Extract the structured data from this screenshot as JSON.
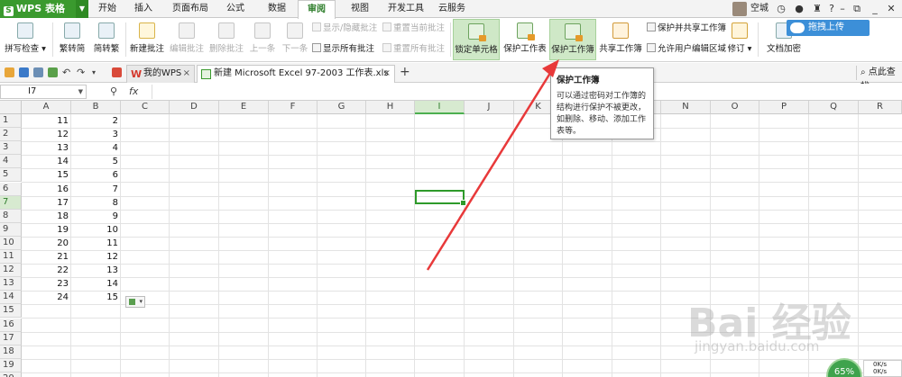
{
  "app": {
    "title": "WPS 表格",
    "accent": "#3a9a2e"
  },
  "menu_tabs": [
    {
      "label": "开始"
    },
    {
      "label": "插入"
    },
    {
      "label": "页面布局"
    },
    {
      "label": "公式"
    },
    {
      "label": "数据"
    },
    {
      "label": "审阅",
      "active": true
    },
    {
      "label": "视图"
    },
    {
      "label": "开发工具"
    },
    {
      "label": "云服务"
    }
  ],
  "user": {
    "name": "空城"
  },
  "ribbon": {
    "spellcheck": "拼写检查",
    "trad_to_simp": "繁转简",
    "simp_to_trad": "简转繁",
    "new_comment": "新建批注",
    "edit_comment": "编辑批注",
    "delete_comment": "删除批注",
    "prev": "上一条",
    "next": "下一条",
    "show_hide_comment": "显示/隐藏批注",
    "show_all_comments": "显示所有批注",
    "reset_current_comment": "重置当前批注",
    "reset_all_comments": "重置所有批注",
    "lock_cell": "锁定单元格",
    "protect_sheet": "保护工作表",
    "protect_workbook": "保护工作簿",
    "share_workbook": "共享工作簿",
    "protect_and_share": "保护并共享工作簿",
    "allow_edit_ranges": "允许用户编辑区域",
    "track_changes": "修订",
    "doc_encrypt": "文档加密",
    "upload": "拖拽上传"
  },
  "doc_tabs": [
    {
      "label": "我的WPS"
    },
    {
      "label": "新建 Microsoft Excel 97-2003 工作表.xls *",
      "active": true
    }
  ],
  "search": {
    "label": "点此查找"
  },
  "formula_bar": {
    "cell_ref": "I7",
    "fx": "fx"
  },
  "columns": [
    "A",
    "B",
    "C",
    "D",
    "E",
    "F",
    "G",
    "H",
    "I",
    "J",
    "K",
    "L",
    "M",
    "N",
    "O",
    "P",
    "Q",
    "R"
  ],
  "rows": [
    "1",
    "2",
    "3",
    "4",
    "5",
    "6",
    "7",
    "8",
    "9",
    "10",
    "11",
    "12",
    "13",
    "14",
    "15",
    "16",
    "17",
    "18",
    "19",
    "20"
  ],
  "cells": {
    "A": [
      "11",
      "12",
      "13",
      "14",
      "15",
      "16",
      "17",
      "18",
      "19",
      "20",
      "21",
      "22",
      "23",
      "24"
    ],
    "B": [
      "2",
      "3",
      "4",
      "5",
      "6",
      "7",
      "8",
      "9",
      "10",
      "11",
      "12",
      "13",
      "14",
      "15"
    ]
  },
  "tooltip": {
    "title": "保护工作簿",
    "body": "可以通过密码对工作簿的结构进行保护不被更改，如删除、移动、添加工作表等。"
  },
  "watermark": {
    "text": "Bai 经验",
    "url": "jingyan.baidu.com"
  },
  "status": {
    "perf": "65%",
    "net_up": "0K/s",
    "net_down": "0K/s"
  }
}
